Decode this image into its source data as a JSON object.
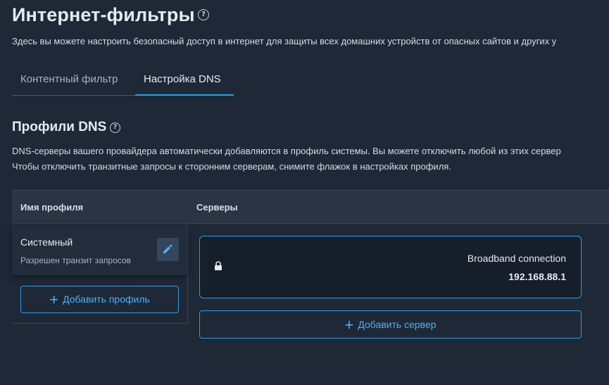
{
  "header": {
    "title": "Интернет-фильтры",
    "help_icon": "?",
    "subtitle": "Здесь вы можете настроить безопасный доступ в интернет для защиты всех домашних устройств от опасных сайтов и других у"
  },
  "tabs": [
    {
      "label": "Контентный фильтр",
      "active": false
    },
    {
      "label": "Настройка DNS",
      "active": true
    }
  ],
  "section": {
    "title": "Профили DNS",
    "help_icon": "?",
    "desc_line1": "DNS-серверы вашего провайдера автоматически добавляются в профиль системы. Вы можете отключить любой из этих сервер",
    "desc_line2": "Чтобы отключить транзитные запросы к сторонним серверам, снимите флажок в настройках профиля."
  },
  "table": {
    "col_name": "Имя профиля",
    "col_servers": "Серверы"
  },
  "profile": {
    "name": "Системный",
    "status": "Разрешен транзит запросов",
    "edit_icon": "pencil-icon"
  },
  "add_profile": {
    "plus": "+",
    "label": "Добавить профиль"
  },
  "server": {
    "lock_icon": "lock-icon",
    "name": "Broadband connection",
    "ip": "192.168.88.1"
  },
  "add_server": {
    "plus": "+",
    "label": "Добавить сервер"
  },
  "colors": {
    "background": "#1e2837",
    "accent": "#2f9be6",
    "table_header": "#2b3442"
  }
}
